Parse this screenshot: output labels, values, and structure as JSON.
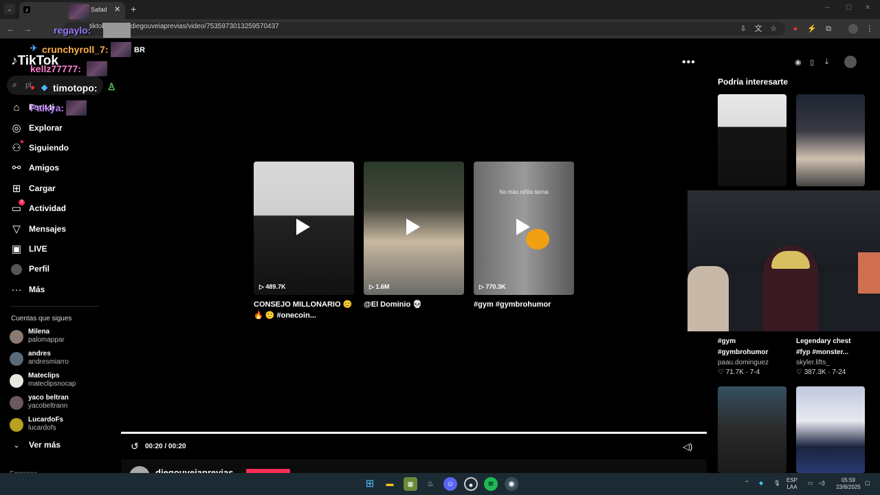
{
  "browser": {
    "tab_title": "Safad",
    "url": "diegouveiaprevias/video/7535973013259570437",
    "url_prefix": "tiktok"
  },
  "sidebar": {
    "logo": "TikTok",
    "search_placeholder": "pl",
    "items": [
      {
        "label": "Para ti",
        "icon": "home-icon"
      },
      {
        "label": "Explorar",
        "icon": "compass-icon"
      },
      {
        "label": "Siguiendo",
        "icon": "following-icon"
      },
      {
        "label": "Amigos",
        "icon": "friends-icon"
      },
      {
        "label": "Cargar",
        "icon": "upload-icon"
      },
      {
        "label": "Actividad",
        "icon": "activity-icon",
        "badge": "3"
      },
      {
        "label": "Mensajes",
        "icon": "messages-icon"
      },
      {
        "label": "LIVE",
        "icon": "live-icon"
      },
      {
        "label": "Perfil",
        "icon": "profile-icon"
      },
      {
        "label": "Más",
        "icon": "more-icon"
      }
    ],
    "following_title": "Cuentas que sigues",
    "accounts": [
      {
        "name": "Milena",
        "handle": "palomappar"
      },
      {
        "name": "andres",
        "handle": "andresmiarro"
      },
      {
        "name": "Mateclips",
        "handle": "mateclipsnocap"
      },
      {
        "name": "yaco beltran",
        "handle": "yacobeltrann"
      },
      {
        "name": "LucardoFs",
        "handle": "lucardofs"
      }
    ],
    "see_more": "Ver más",
    "companies_label": "Empresa"
  },
  "chat": [
    {
      "user": "regaylo:",
      "color": "#9b7bff"
    },
    {
      "user": "crunchyroll_7:",
      "color": "#ffb04a",
      "text": "BR"
    },
    {
      "user": "kellz77777:",
      "color": "#ff7fd0"
    },
    {
      "user": "timotopo:",
      "color": "#ffffff"
    },
    {
      "user": "Palkya:",
      "color": "#c080ff"
    }
  ],
  "player": {
    "end_cards": [
      {
        "views": "489.7K",
        "caption_l1": "CONSEJO MILLONARIO 😊",
        "caption_l2": "🔥 🙂 #onecoin..."
      },
      {
        "views": "1.6M",
        "caption_l1": "@El Dominio 💀",
        "caption_l2": ""
      },
      {
        "views": "770.3K",
        "caption_l1": "#gym #gymbrohumor",
        "caption_l2": "",
        "overlay_text": "No más niñita tierna"
      }
    ],
    "time": "00:20 / 00:20",
    "progress": 1.0,
    "author": "diegouveiaprevias"
  },
  "suggested": {
    "title": "Podría interesarte",
    "items": [
      {
        "cap_l1": "#gym",
        "cap_l2": "#gymbrohumor",
        "user": "paau.dominguez",
        "likes": "71.7K",
        "date": "7-4"
      },
      {
        "cap_l1": "Legendary chest",
        "cap_l2": "#fyp #monster...",
        "user": "skyler.lifts_",
        "likes": "387.3K",
        "date": "7-24"
      }
    ]
  },
  "taskbar": {
    "lang_l1": "ESP",
    "lang_l2": "LAA",
    "time": "05:59",
    "date": "23/8/2025"
  }
}
